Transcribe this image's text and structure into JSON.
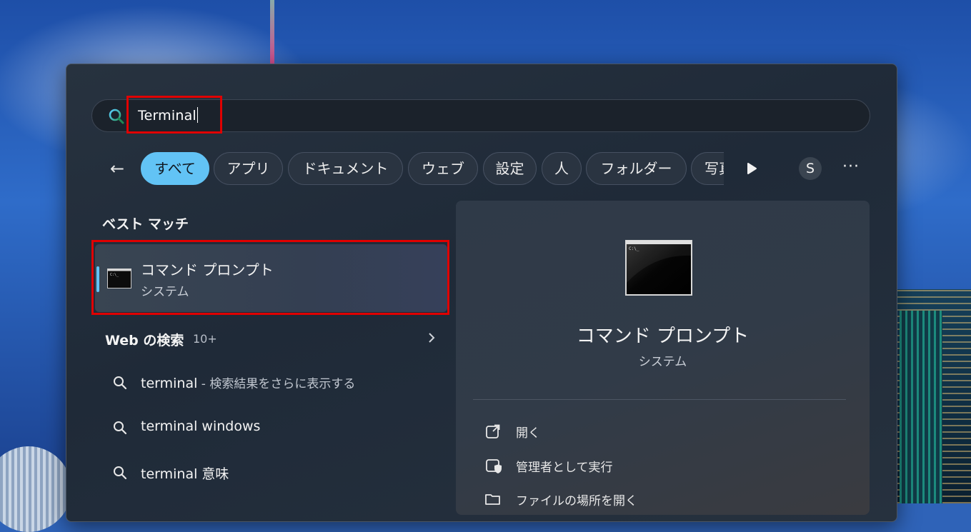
{
  "search": {
    "query": "Terminal"
  },
  "filters": {
    "back_label": "←",
    "chips": [
      "すべて",
      "アプリ",
      "ドキュメント",
      "ウェブ",
      "設定",
      "人",
      "フォルダー",
      "写真"
    ],
    "avatar_initial": "S",
    "more_label": "···"
  },
  "best_match": {
    "heading": "ベスト マッチ",
    "name": "コマンド プロンプト",
    "type": "システム"
  },
  "web_search": {
    "heading": "Web の検索",
    "count": "10+",
    "suggestions": [
      {
        "term": "terminal",
        "suffix": " - 検索結果をさらに表示する"
      },
      {
        "term": "terminal windows",
        "suffix": ""
      },
      {
        "term": "terminal 意味",
        "suffix": ""
      }
    ]
  },
  "detail": {
    "name": "コマンド プロンプト",
    "type": "システム",
    "actions": [
      "開く",
      "管理者として実行",
      "ファイルの場所を開く"
    ]
  },
  "colors": {
    "accent": "#62c3f5",
    "highlight": "#e00000",
    "panel": "#232d3a"
  },
  "icons": [
    "search-icon",
    "back-arrow-icon",
    "play-icon",
    "more-icon",
    "command-prompt-icon",
    "chevron-right-icon",
    "external-link-icon",
    "shield-icon",
    "folder-icon"
  ]
}
